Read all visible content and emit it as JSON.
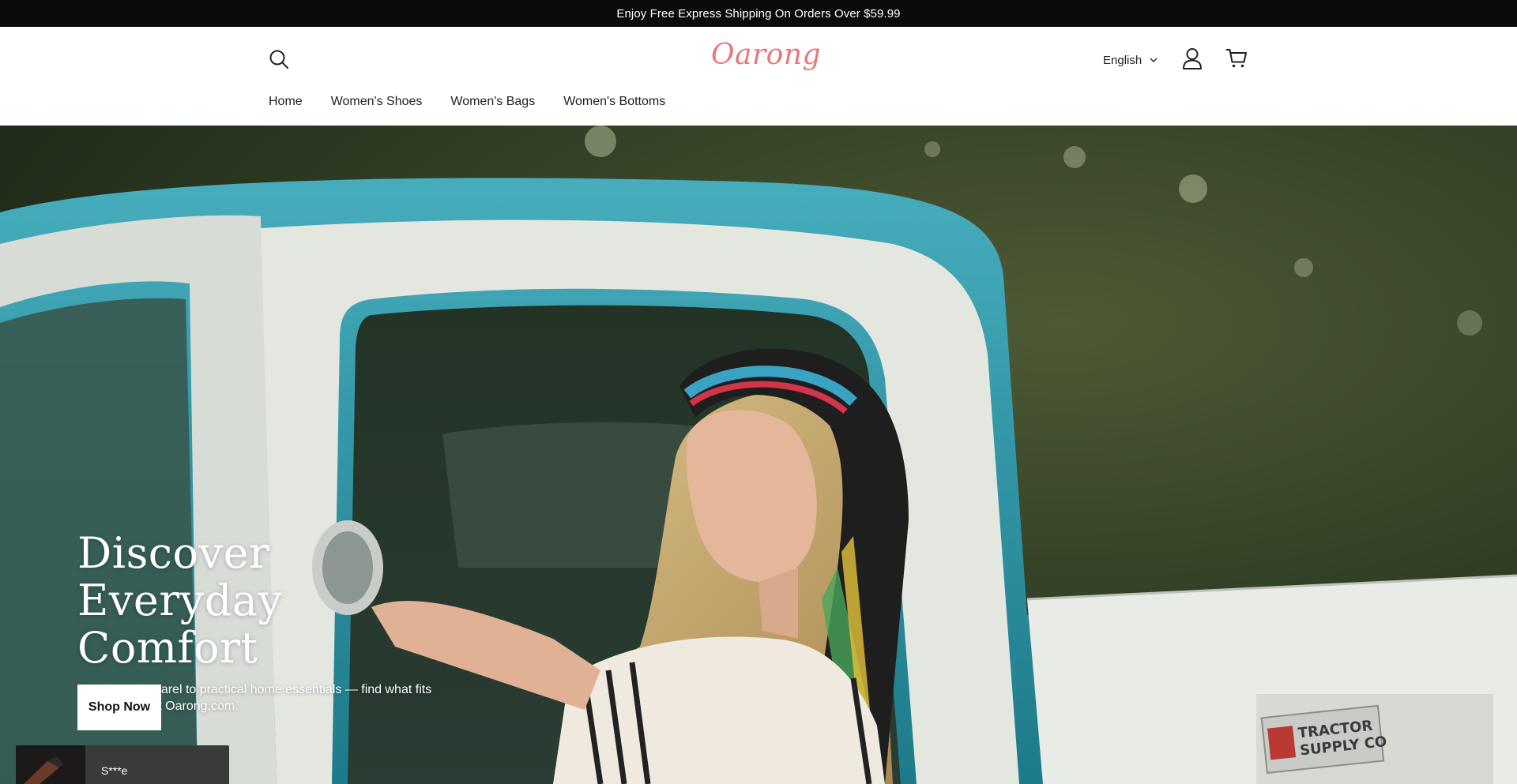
{
  "announcement": {
    "text": "Enjoy Free Express Shipping On Orders Over $59.99"
  },
  "header": {
    "logo_text": "Oarong",
    "language": "English",
    "icons": {
      "search": "search-icon",
      "account": "user-icon",
      "cart": "cart-icon",
      "language_chevron": "chevron-down-icon"
    }
  },
  "nav": {
    "items": [
      {
        "label": "Home"
      },
      {
        "label": "Women's Shoes"
      },
      {
        "label": "Women's Bags"
      },
      {
        "label": "Women's Bottoms"
      }
    ]
  },
  "hero": {
    "title_line1": "Discover Everyday",
    "title_line2": "Comfort",
    "subtitle": "From cozy apparel to practical home essentials — find what fits your lifestyle at Oarong.com.",
    "cta_label": "Shop Now",
    "truck_sign": "TRACTOR SUPPLY CO"
  },
  "toast": {
    "name": "S***e"
  },
  "colors": {
    "announce_bg": "#0b0b0b",
    "logo": "#e8767c",
    "truck_teal": "#2f97a8",
    "cta_bg": "#ffffff"
  }
}
